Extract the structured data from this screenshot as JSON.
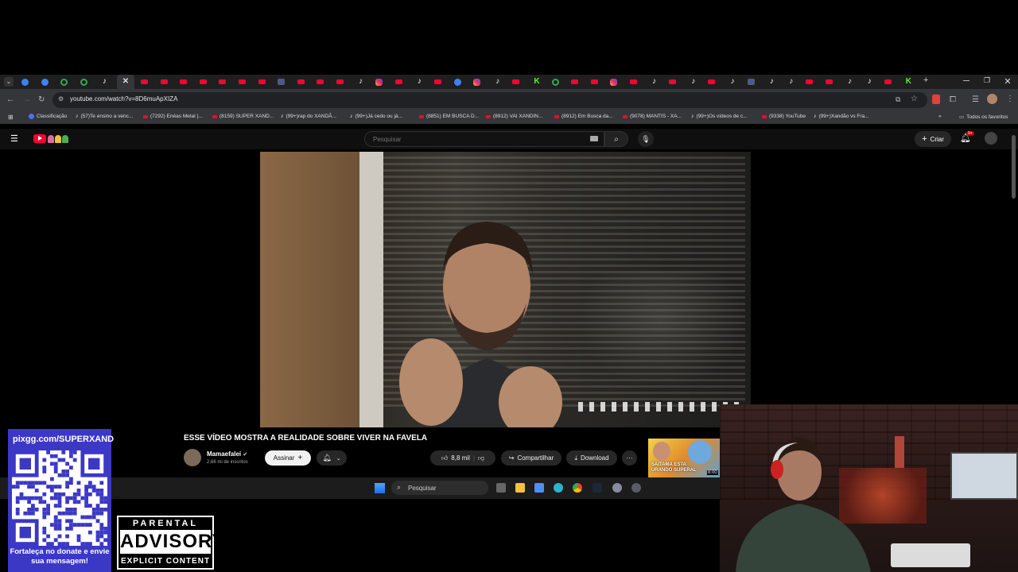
{
  "browser": {
    "tabs": [
      {
        "kind": "circle"
      },
      {
        "kind": "circle"
      },
      {
        "kind": "google"
      },
      {
        "kind": "google"
      },
      {
        "kind": "tt"
      },
      {
        "kind": "tt"
      },
      {
        "kind": "active",
        "label": "✕"
      },
      {
        "kind": "yt"
      },
      {
        "kind": "yt"
      },
      {
        "kind": "yt"
      },
      {
        "kind": "yt"
      },
      {
        "kind": "yt"
      },
      {
        "kind": "yt"
      },
      {
        "kind": "yt"
      },
      {
        "kind": "sq"
      },
      {
        "kind": "yt"
      },
      {
        "kind": "yt"
      },
      {
        "kind": "yt"
      },
      {
        "kind": "tt"
      },
      {
        "kind": "ig"
      },
      {
        "kind": "yt"
      },
      {
        "kind": "tt"
      },
      {
        "kind": "yt"
      },
      {
        "kind": "circle"
      },
      {
        "kind": "ig"
      },
      {
        "kind": "tt"
      },
      {
        "kind": "yt"
      },
      {
        "kind": "kick"
      },
      {
        "kind": "google"
      },
      {
        "kind": "yt"
      },
      {
        "kind": "yt"
      },
      {
        "kind": "ig"
      },
      {
        "kind": "yt"
      },
      {
        "kind": "tt"
      },
      {
        "kind": "yt"
      },
      {
        "kind": "tt"
      },
      {
        "kind": "yt"
      },
      {
        "kind": "tt"
      },
      {
        "kind": "sq"
      },
      {
        "kind": "tt"
      },
      {
        "kind": "tt"
      },
      {
        "kind": "yt"
      },
      {
        "kind": "yt"
      },
      {
        "kind": "tt"
      },
      {
        "kind": "tt"
      },
      {
        "kind": "yt"
      },
      {
        "kind": "kick"
      }
    ],
    "url": "youtube.com/watch?v=8D6muApXIZA",
    "bookmarks": [
      {
        "label": "Classificação",
        "icon": "circle"
      },
      {
        "label": "(57)Te ensino a venc...",
        "icon": "tt"
      },
      {
        "label": "(7292) Enéas Metal |...",
        "icon": "yt"
      },
      {
        "label": "(8159) SUPER XAND...",
        "icon": "yt"
      },
      {
        "label": "(99+)rap do XANDÃ...",
        "icon": "tt"
      },
      {
        "label": "(99+)Já cedo ou já...",
        "icon": "tt"
      },
      {
        "label": "(8851) EM BUSCA D...",
        "icon": "yt"
      },
      {
        "label": "(8912) VAI XANDIN...",
        "icon": "yt"
      },
      {
        "label": "(8912) Em Busca da...",
        "icon": "yt"
      },
      {
        "label": "(9078) MANTIS - XA...",
        "icon": "yt"
      },
      {
        "label": "(99+)Os vídeos de c...",
        "icon": "tt"
      },
      {
        "label": "(9338) YouTube",
        "icon": "yt"
      },
      {
        "label": "(99+)Xandão vs Fra...",
        "icon": "tt"
      }
    ],
    "all_bookmarks_label": "Todos os favoritos",
    "window_controls": {
      "minimize": "─",
      "maximize": "❐",
      "close": "✕"
    }
  },
  "youtube": {
    "search_placeholder": "Pesquisar",
    "create_label": "Criar",
    "notification_count": "9+",
    "video_title": "ESSE VÍDEO MOSTRA A REALIDADE SOBRE VIVER NA FAVELA",
    "channel_name": "Mamaefalei",
    "subscribers": "2,66 mi de inscritos",
    "subscribe_label": "Assinar",
    "likes": "8,8 mil",
    "share_label": "Compartilhar",
    "download_label": "Download",
    "more_label": "···",
    "thumb_text": "SAITAMA ESTA\nURANDO SUPERAL",
    "thumb_time": "8:00"
  },
  "taskbar": {
    "search_placeholder": "Pesquisar"
  },
  "overlay": {
    "qr_url": "pixgg.com/SUPERXAND",
    "qr_text": "Fortaleça no donate e envie sua mensagem!",
    "advisory_top": "PARENTAL",
    "advisory_mid": "ADVISORY",
    "advisory_bottom": "EXPLICIT CONTENT"
  },
  "colors": {
    "youtube_red": "#ff0033",
    "qr_bg": "#3c38c6",
    "kick_green": "#53fc18"
  }
}
